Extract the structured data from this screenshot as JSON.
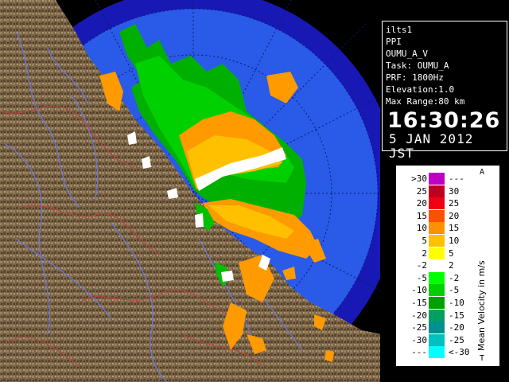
{
  "info": {
    "site": "ilts1",
    "scan_type": "PPI",
    "product": "OUMU_A_V",
    "task": "Task: OUMU_A",
    "prf": "PRF: 1800Hz",
    "elevation": "Elevation:1.0",
    "max_range": "Max Range:80 km",
    "time": "16:30:26",
    "date": "5 JAN 2012 JST"
  },
  "legend": {
    "title": "Mean Velocity in m/s",
    "corner_top": "A",
    "corner_bottom": "T",
    "rows": [
      {
        "left": ">30",
        "right": "---",
        "color": "#c000c0"
      },
      {
        "left": "25",
        "right": "30",
        "color": "#c00020"
      },
      {
        "left": "20",
        "right": "25",
        "color": "#f00010"
      },
      {
        "left": "15",
        "right": "20",
        "color": "#ff5000"
      },
      {
        "left": "10",
        "right": "15",
        "color": "#ff9000"
      },
      {
        "left": "5",
        "right": "10",
        "color": "#ffc000"
      },
      {
        "left": "2",
        "right": "5",
        "color": "#ffff00"
      },
      {
        "left": "-2",
        "right": "2",
        "color": "#ffffff"
      },
      {
        "left": "-5",
        "right": "-2",
        "color": "#00ff00"
      },
      {
        "left": "-10",
        "right": "-5",
        "color": "#00d000"
      },
      {
        "left": "-15",
        "right": "-10",
        "color": "#00a000"
      },
      {
        "left": "-20",
        "right": "-15",
        "color": "#00a060"
      },
      {
        "left": "-25",
        "right": "-20",
        "color": "#009090"
      },
      {
        "left": "-30",
        "right": "-25",
        "color": "#00c0c0"
      },
      {
        "left": "---",
        "right": "<-30",
        "color": "#00ffff"
      }
    ]
  },
  "colors": {
    "outer_ring": "#1818b4",
    "inner_range": "#2a5ae8",
    "land": "#7a6446",
    "river": "#6a78e0",
    "border": "#c04040"
  }
}
